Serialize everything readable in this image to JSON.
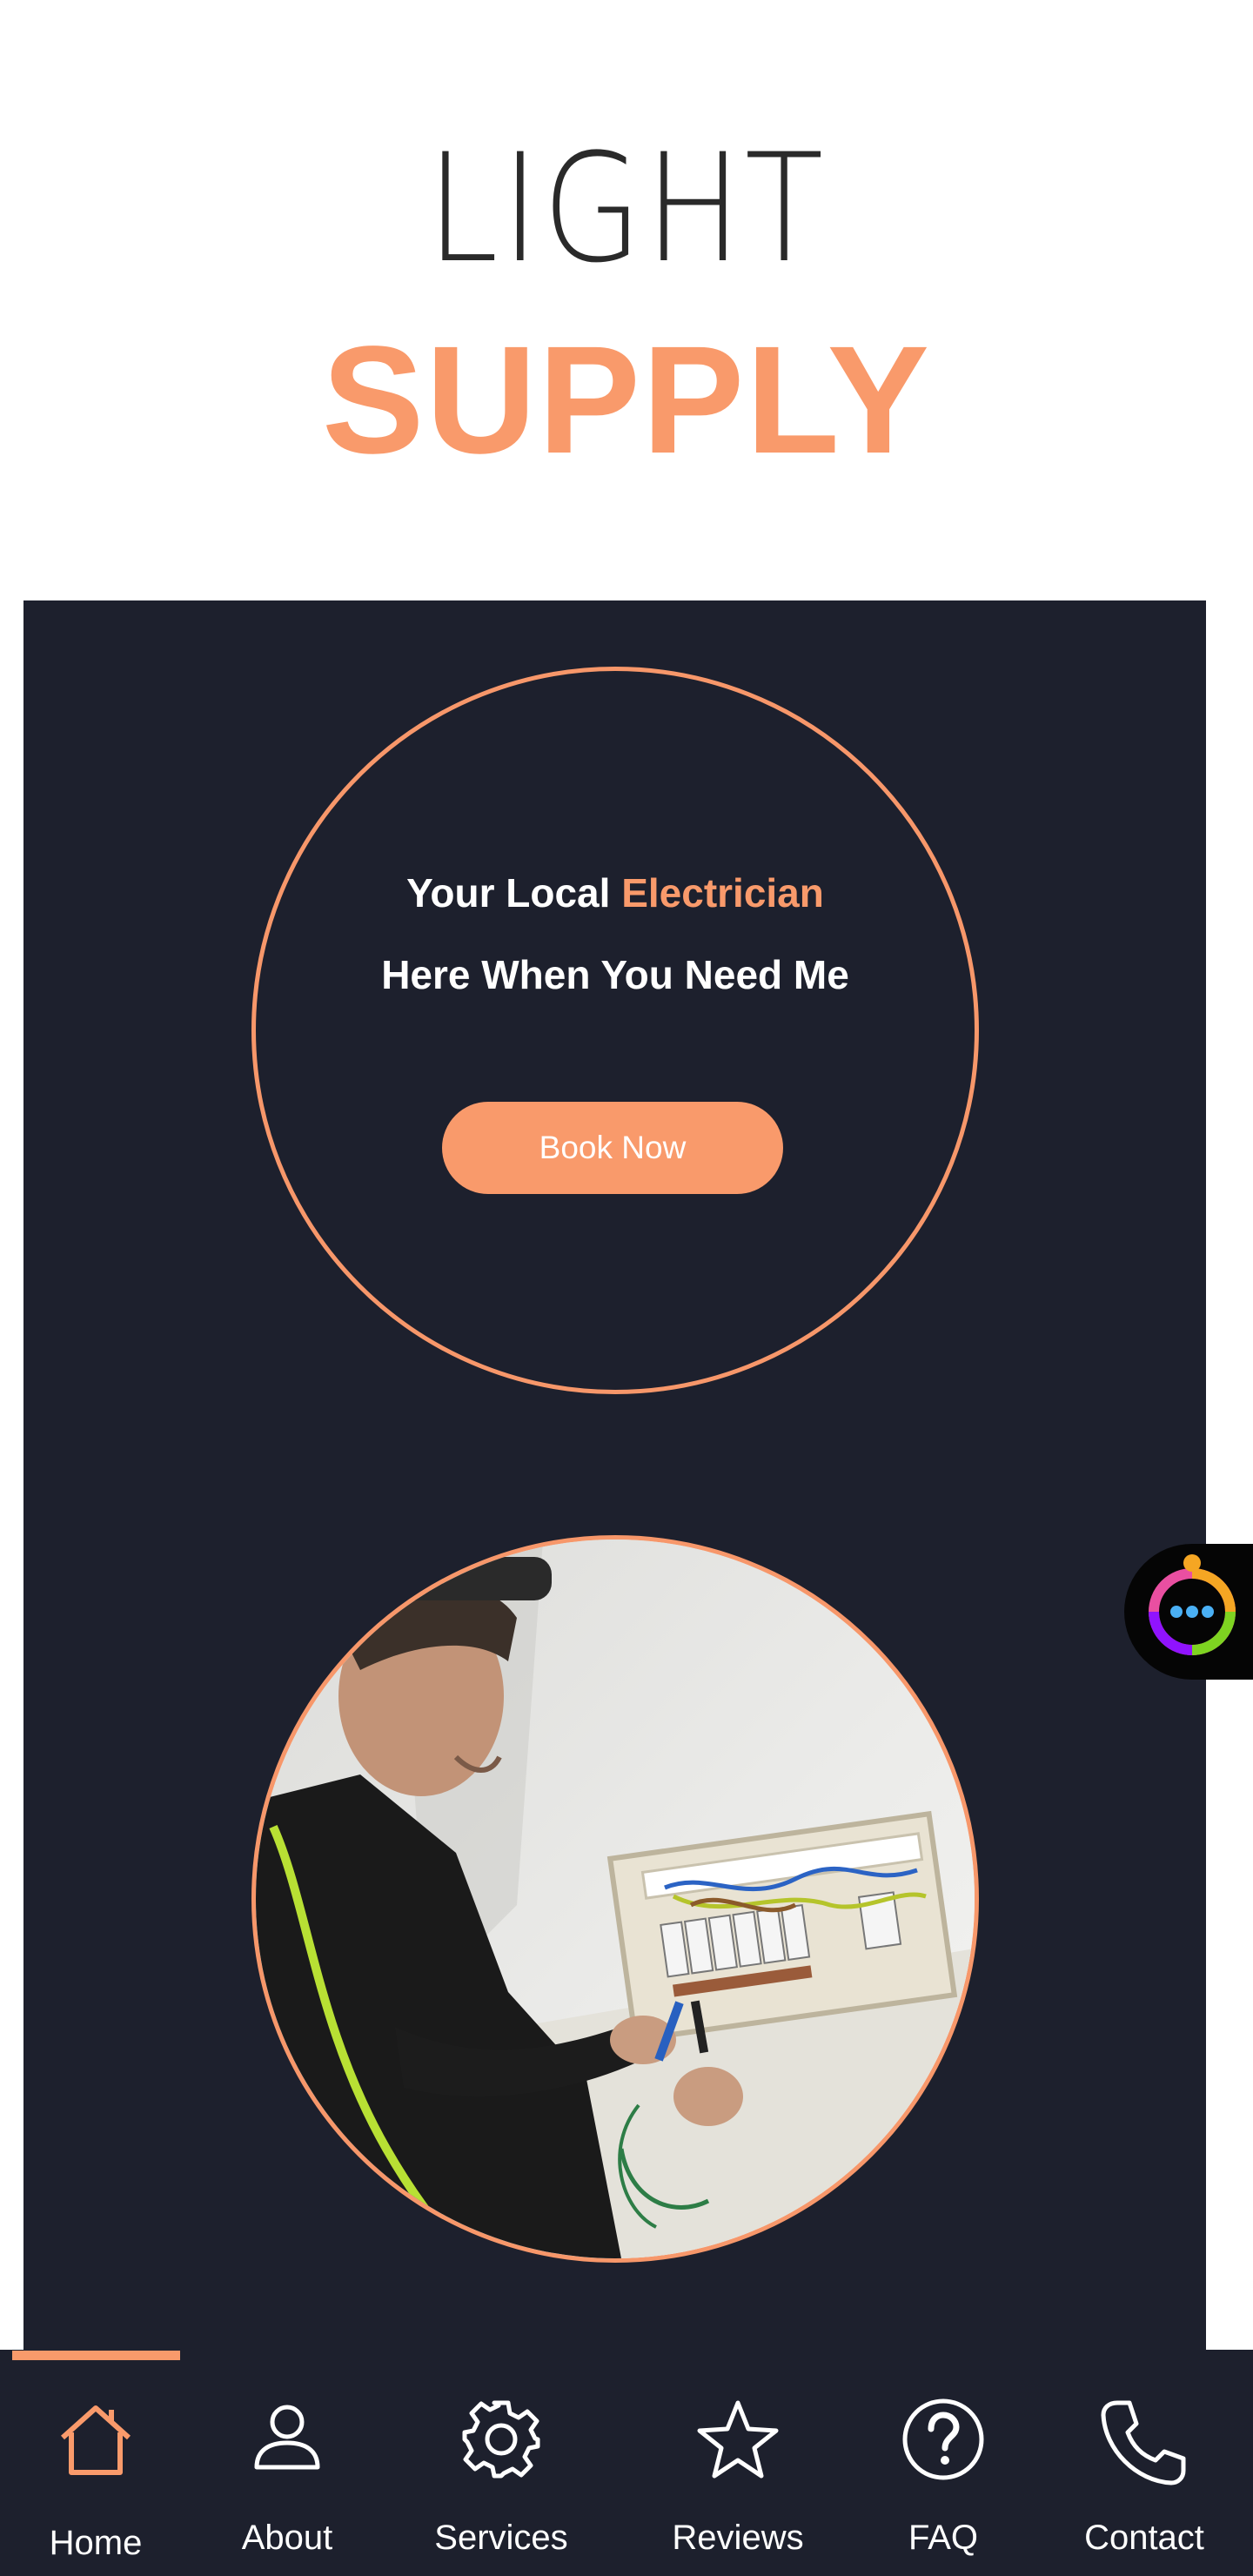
{
  "logo": {
    "line1": "LIGHT",
    "line2": "SUPPLY"
  },
  "hero": {
    "headline_line1_prefix": "Your Local",
    "headline_line1_accent": "Electrician",
    "headline_line2": "Here When You Need Me",
    "cta_label": "Book Now"
  },
  "chat_widget": {
    "icon": "chat-bubble-icon"
  },
  "nav": {
    "items": [
      {
        "label": "Home",
        "icon": "home-icon",
        "active": true
      },
      {
        "label": "About",
        "icon": "user-icon",
        "active": false
      },
      {
        "label": "Services",
        "icon": "gear-icon",
        "active": false
      },
      {
        "label": "Reviews",
        "icon": "star-icon",
        "active": false
      },
      {
        "label": "FAQ",
        "icon": "question-icon",
        "active": false
      },
      {
        "label": "Contact",
        "icon": "phone-icon",
        "active": false
      }
    ]
  },
  "colors": {
    "accent": "#f99a6b",
    "dark": "#1d202d",
    "white": "#ffffff"
  }
}
